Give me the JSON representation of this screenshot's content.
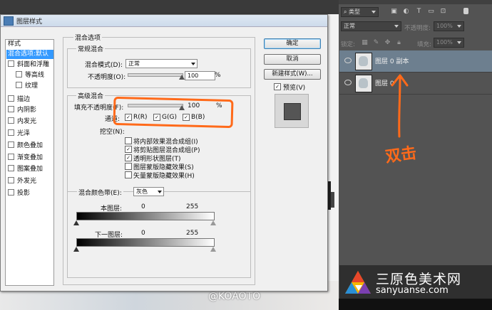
{
  "dialog": {
    "title": "图层样式",
    "styles_header": "样式",
    "style_items": [
      {
        "label": "混合选项:默认",
        "checkbox": false,
        "selected": true
      },
      {
        "label": "斜面和浮雕",
        "checkbox": true
      },
      {
        "label": "等高线",
        "checkbox": true,
        "indent": true
      },
      {
        "label": "纹理",
        "checkbox": true,
        "indent": true
      },
      {
        "label": "描边",
        "checkbox": true
      },
      {
        "label": "内阴影",
        "checkbox": true
      },
      {
        "label": "内发光",
        "checkbox": true
      },
      {
        "label": "光泽",
        "checkbox": true
      },
      {
        "label": "颜色叠加",
        "checkbox": true
      },
      {
        "label": "渐变叠加",
        "checkbox": true
      },
      {
        "label": "图案叠加",
        "checkbox": true
      },
      {
        "label": "外发光",
        "checkbox": true
      },
      {
        "label": "投影",
        "checkbox": true
      }
    ],
    "blending_options_title": "混合选项",
    "general_blending": {
      "title": "常规混合",
      "blend_mode_label": "混合模式(D):",
      "blend_mode_value": "正常",
      "opacity_label": "不透明度(O):",
      "opacity_value": "100",
      "opacity_unit": "%",
      "opacity_level": 1.0
    },
    "advanced_blending": {
      "title": "高级混合",
      "fill_opacity_label": "填充不透明度(F):",
      "fill_opacity_value": "100",
      "fill_opacity_unit": "%",
      "fill_opacity_level": 1.0,
      "channels_label": "通道:",
      "channels": [
        {
          "label": "R(R)",
          "checked": true
        },
        {
          "label": "G(G)",
          "checked": true
        },
        {
          "label": "B(B)",
          "checked": true
        }
      ],
      "knockout_label": "挖空(N):",
      "options": [
        {
          "label": "将内部效果混合成组(I)",
          "checked": false
        },
        {
          "label": "将剪贴图层混合成组(P)",
          "checked": true
        },
        {
          "label": "透明形状图层(T)",
          "checked": true
        },
        {
          "label": "图层蒙版隐藏效果(S)",
          "checked": false
        },
        {
          "label": "矢量蒙版隐藏效果(H)",
          "checked": false
        }
      ]
    },
    "blend_if": {
      "label": "混合颜色带(E):",
      "value": "灰色",
      "this_layer_label": "本图层:",
      "this_layer_min": "0",
      "this_layer_max": "255",
      "underlying_label": "下一图层:",
      "underlying_min": "0",
      "underlying_max": "255"
    },
    "buttons": {
      "ok": "确定",
      "cancel": "取消",
      "new_style": "新建样式(W)...",
      "preview_label": "预览(V)",
      "preview_checked": true
    }
  },
  "layers_panel": {
    "filter_kind": "类型",
    "blend_mode": "正常",
    "opacity_label": "不透明度:",
    "opacity_value": "100%",
    "lock_label": "锁定:",
    "fill_label": "填充:",
    "fill_value": "100%",
    "layers": [
      {
        "name": "图层 0 副本",
        "selected": true
      },
      {
        "name": "图层 0",
        "selected": false
      }
    ]
  },
  "annotation": {
    "text": "双击",
    "color": "#ff6a1a"
  },
  "watermark": "@KOAOTO",
  "logo": {
    "cn": "三原色美术网",
    "en": "sanyuanse.com"
  }
}
